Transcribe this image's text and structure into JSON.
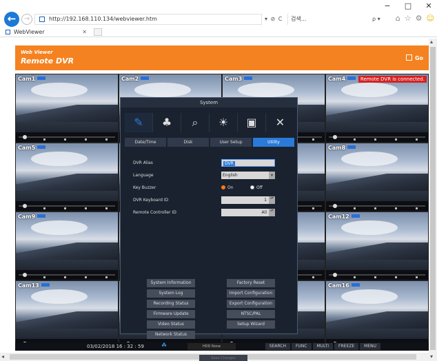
{
  "window_controls": {
    "minimize": "−",
    "maximize": "□",
    "close": "✕"
  },
  "browser": {
    "url": "http://192.168.110.134/webviewer.htm",
    "addr_controls": "▾ ⊘ C",
    "search_placeholder": "검색...",
    "search_controls": "ρ ▾",
    "tab_title": "WebViewer",
    "tab_close": "✕"
  },
  "banner": {
    "brand_line1": "Web Viewer",
    "brand_line2": "Remote DVR",
    "go_label": "Go"
  },
  "cameras": [
    "Cam1",
    "Cam2",
    "Cam3",
    "Cam4",
    "Cam5",
    "Cam",
    "",
    "Cam8",
    "Cam9",
    "Cam",
    "",
    "Cam12",
    "Cam13",
    "Cam",
    "",
    "Cam16"
  ],
  "connection_message": "Remote DVR is connected.",
  "status_bar": {
    "datetime": "03/02/2018 16 : 32 : 59",
    "hdd": "HDD None",
    "buttons": [
      "SEARCH",
      "FUNC",
      "MULTI",
      "FREEZE",
      "MENU"
    ]
  },
  "dialog": {
    "title": "System",
    "category_tabs": [
      "Date/Time",
      "Disk",
      "User Setup",
      "Utility"
    ],
    "active_category": "Utility",
    "fields": {
      "dvr_alias_label": "DVR Alias",
      "dvr_alias_value": "DVR",
      "language_label": "Language",
      "language_value": "English",
      "key_buzzer_label": "Key Buzzer",
      "key_buzzer_on": "On",
      "key_buzzer_off": "Off",
      "keyboard_id_label": "DVR Keyboard ID",
      "keyboard_id_value": "1",
      "remote_id_label": "Remote Controller ID",
      "remote_id_value": "All"
    },
    "actions_left": [
      "System Information",
      "System Log",
      "Recording Status",
      "Firmware Update",
      "Video Status",
      "Network Status"
    ],
    "actions_right": [
      "Factory Reset",
      "Import Configuration",
      "Export Configuration",
      "NTSC/PAL",
      "Setup Wizard"
    ],
    "disabled_button": "Save Changes"
  }
}
